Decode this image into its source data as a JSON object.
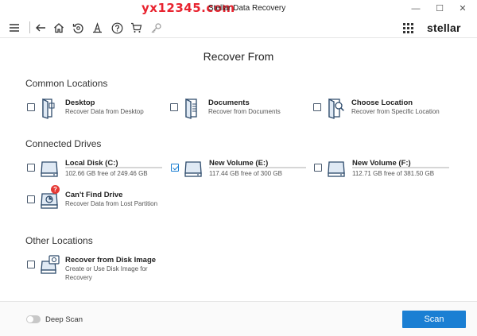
{
  "titlebar": {
    "watermark": "yx12345.com",
    "title": "Stellar Data Recovery",
    "minimize": "—",
    "maximize": "☐",
    "close": "✕"
  },
  "toolbar": {
    "icons": [
      "menu-icon",
      "back-icon",
      "home-icon",
      "recover-icon",
      "hand-tool-icon",
      "help-icon",
      "cart-icon",
      "key-icon",
      "apps-grid-icon"
    ],
    "brand": "stellar"
  },
  "main": {
    "page_title": "Recover From",
    "sections": {
      "common": {
        "title": "Common Locations",
        "items": [
          {
            "label": "Desktop",
            "sub": "Recover Data from Desktop",
            "checked": false
          },
          {
            "label": "Documents",
            "sub": "Recover from Documents",
            "checked": false
          },
          {
            "label": "Choose Location",
            "sub": "Recover from Specific Location",
            "checked": false
          }
        ]
      },
      "drives": {
        "title": "Connected Drives",
        "items": [
          {
            "label": "Local Disk (C:)",
            "sub": "102.66 GB free of 249.46 GB",
            "checked": false,
            "used_fraction": 0.59
          },
          {
            "label": "New Volume (E:)",
            "sub": "117.44 GB free of 300 GB",
            "checked": true,
            "used_fraction": 0.61
          },
          {
            "label": "New Volume (F:)",
            "sub": "112.71 GB free of 381.50 GB",
            "checked": false,
            "used_fraction": 0.7
          }
        ],
        "cant_find": {
          "label": "Can't Find Drive",
          "sub": "Recover Data from Lost Partition",
          "badge": "?",
          "checked": false
        }
      },
      "other": {
        "title": "Other Locations",
        "items": [
          {
            "label": "Recover from Disk Image",
            "sub_line1": "Create or Use Disk Image for",
            "sub_line2": "Recovery",
            "checked": false
          }
        ]
      }
    }
  },
  "footer": {
    "deep_scan_label": "Deep Scan",
    "deep_scan_on": false,
    "scan_label": "Scan"
  },
  "colors": {
    "accent": "#1b7fd3",
    "watermark": "#e8232f",
    "badge": "#e53935"
  }
}
